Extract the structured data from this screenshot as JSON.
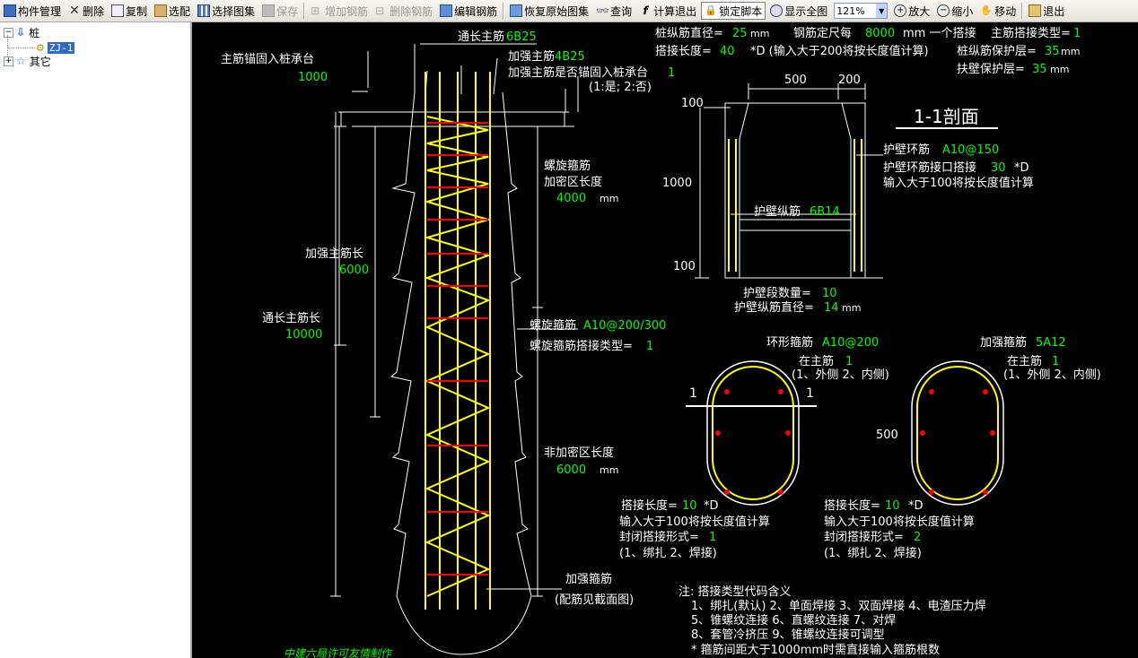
{
  "toolbar": {
    "component_mgmt": "构件管理",
    "delete": "删除",
    "copy": "复制",
    "pick": "选配",
    "select_atlas": "选择图集",
    "save": "保存",
    "add_rebar": "增加钢筋",
    "delete_rebar": "删除钢筋",
    "edit_rebar": "编辑钢筋",
    "restore_atlas": "恢复原始图集",
    "query": "查询",
    "calc_exit": "计算退出",
    "lock_script": "锁定脚本",
    "show_all": "显示全图",
    "zoom_value": "121%",
    "zoom_in": "放大",
    "zoom_out": "缩小",
    "move": "移动",
    "exit": "退出"
  },
  "tree": {
    "root": "桩",
    "child": "ZJ-1",
    "other": "其它"
  },
  "drawing": {
    "lbl_tongchang": "通长主筋",
    "val_tongchang": "6B25",
    "lbl_jiaqiang": "加强主筋",
    "val_jiaqiang": "4B25",
    "lbl_anchor_q": "加强主筋是否锚固入桩承台",
    "val_anchor_q": "1",
    "anchor_opts": "(1:是; 2:否)",
    "lbl_main_anchor": "主筋锚固入桩承台",
    "val_main_anchor": "1000",
    "lbl_spiral": "螺旋箍筋",
    "lbl_dense_len": "加密区长度",
    "val_dense_len": "4000",
    "unit_mm": "mm",
    "lbl_reinf_len": "加强主筋长",
    "val_reinf_len": "6000",
    "lbl_full_len": "通长主筋长",
    "val_full_len": "10000",
    "lbl_spiral2": "螺旋箍筋",
    "val_spiral2": "A10@200/300",
    "lbl_spiral_lap": "螺旋箍筋搭接类型=",
    "val_spiral_lap": "1",
    "lbl_nondense": "非加密区长度",
    "val_nondense": "6000",
    "lbl_reinf_stirrup": "加强箍筋",
    "note_section": "(配筋见截面图)",
    "lbl_pile_dia": "桩纵筋直径=",
    "val_pile_dia": "25",
    "lbl_rebar_len": "钢筋定尺每",
    "val_rebar_len": "8000",
    "txt_one_lap": "mm 一个搭接",
    "lbl_main_lap_type": "主筋搭接类型=",
    "val_main_lap_type": "1",
    "lbl_lap_len": "搭接长度=",
    "val_lap_len": "40",
    "txt_lap_note": "*D (输入大于200将按长度值计算)",
    "lbl_cover": "桩纵筋保护层=",
    "val_cover": "35",
    "lbl_wall_cover": "扶壁保护层=",
    "val_wall_cover": "35",
    "dim_500": "500",
    "dim_200": "200",
    "dim_100a": "100",
    "dim_1000": "1000",
    "dim_100b": "100",
    "section_title": "1-1剖面",
    "lbl_ring": "护壁环筋",
    "val_ring": "A10@150",
    "lbl_ring_lap": "护壁环筋接口搭接",
    "val_ring_lap": "30",
    "txt_ring_lap_d": "*D",
    "txt_ring_note": "输入大于100将按长度值计算",
    "lbl_wall_long": "护壁纵筋",
    "val_wall_long": "6B14",
    "lbl_wall_seg": "护壁段数量=",
    "val_wall_seg": "10",
    "lbl_wall_dia": "护壁纵筋直径=",
    "val_wall_dia": "14",
    "lbl_hoop": "环形箍筋",
    "val_hoop": "A10@200",
    "lbl_at_main1": "在主筋",
    "val_at_main1": "1",
    "txt_inout1": "(1、外侧  2、内侧)",
    "lbl_reinf_hoop": "加强箍筋",
    "val_reinf_hoop": "5A12",
    "lbl_at_main2": "在主筋",
    "val_at_main2": "1",
    "txt_inout2": "(1、外侧  2、内侧)",
    "cut_label_l": "1",
    "cut_label_r": "1",
    "dim_500b": "500",
    "lbl_lap1": "搭接长度=",
    "val_lap1": "10",
    "txt_d1": "*D",
    "txt_note1": "输入大于100将按长度值计算",
    "lbl_close1": "封闭搭接形式=",
    "val_close1": "1",
    "txt_close_opts1": "(1、绑扎  2、焊接)",
    "lbl_lap2": "搭接长度=",
    "val_lap2": "10",
    "txt_d2": "*D",
    "txt_note2": "输入大于100将按长度值计算",
    "lbl_close2": "封闭搭接形式=",
    "val_close2": "2",
    "txt_close_opts2": "(1、绑扎  2、焊接)",
    "note_title": "注: 搭接类型代码含义",
    "note_line1": "1、绑扎(默认)   2、单面焊接    3、双面焊接    4、电渣压力焊",
    "note_line2": "5、锥螺纹连接    6、直螺纹连接    7、对焊",
    "note_line3": "8、套管冷挤压    9、锥螺纹连接可调型",
    "note_line4": "* 箍筋间距大于1000mm时需直接输入箍筋根数",
    "credit": "中建六局许可友情制作"
  },
  "colors": {
    "canvas_bg": "#000000",
    "line": "#ffffff",
    "value": "#00ff00",
    "rebar": "#ffff00",
    "stirrup": "#ff0000",
    "selection": "#316ac5"
  }
}
